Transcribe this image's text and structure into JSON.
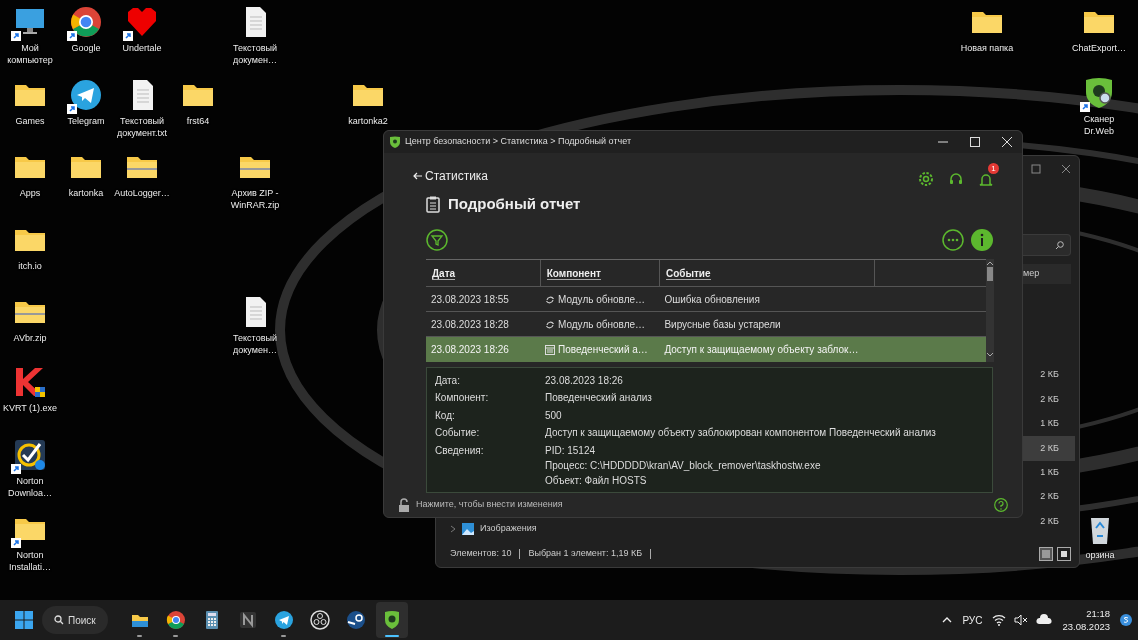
{
  "desktop_icons": [
    {
      "label": "Мой компьютер",
      "kind": "monitor",
      "shortcut": true
    },
    {
      "label": "Google",
      "kind": "chrome",
      "shortcut": true
    },
    {
      "label": "Undertale",
      "kind": "heart",
      "shortcut": true
    },
    {
      "label": "Текстовый докумен…",
      "kind": "document",
      "shortcut": false
    },
    {
      "label": "Новая папка",
      "kind": "folder",
      "shortcut": false
    },
    {
      "label": "ChatExport…",
      "kind": "folder",
      "shortcut": false
    },
    {
      "label": "Games",
      "kind": "folder",
      "shortcut": false
    },
    {
      "label": "Telegram",
      "kind": "telegram",
      "shortcut": true
    },
    {
      "label": "Текстовый документ.txt",
      "kind": "document",
      "shortcut": false
    },
    {
      "label": "frst64",
      "kind": "folder",
      "shortcut": false
    },
    {
      "label": "kartonka2",
      "kind": "folder",
      "shortcut": false
    },
    {
      "label": "Сканер Dr.Web",
      "kind": "drweb",
      "shortcut": true
    },
    {
      "label": "Apps",
      "kind": "folder",
      "shortcut": false
    },
    {
      "label": "kartonka",
      "kind": "folder",
      "shortcut": false
    },
    {
      "label": "AutoLogger…",
      "kind": "archive",
      "shortcut": false
    },
    {
      "label": "Архив ZIP - WinRAR.zip",
      "kind": "archive",
      "shortcut": false
    },
    {
      "label": "itch.io",
      "kind": "folder",
      "shortcut": false
    },
    {
      "label": "AVbr.zip",
      "kind": "archive",
      "shortcut": false
    },
    {
      "label": "Текстовый докумен…",
      "kind": "document",
      "shortcut": false
    },
    {
      "label": "KVRT (1).exe",
      "kind": "kaspersky",
      "shortcut": false
    },
    {
      "label": "Norton Downloa…",
      "kind": "norton",
      "shortcut": true
    },
    {
      "label": "Norton Installati…",
      "kind": "folder",
      "shortcut": true
    },
    {
      "label": "орзина",
      "kind": "recycle",
      "shortcut": false
    }
  ],
  "explorer_window": {
    "column_header": "мер",
    "sizes": [
      {
        "text": "2 КБ",
        "selected": false
      },
      {
        "text": "2 КБ",
        "selected": false
      },
      {
        "text": "1 КБ",
        "selected": false
      },
      {
        "text": "2 КБ",
        "selected": true
      },
      {
        "text": "1 КБ",
        "selected": false
      },
      {
        "text": "2 КБ",
        "selected": false
      },
      {
        "text": "2 КБ",
        "selected": false
      }
    ],
    "nav_item": "Изображения",
    "status": [
      "Элементов: 10",
      "Выбран 1 элемент: 1,19 КБ"
    ],
    "view_buttons": [
      {
        "kind": "details",
        "selected": true
      },
      {
        "kind": "tiles",
        "selected": false
      }
    ]
  },
  "security_window": {
    "title": "Центр безопасности > Статистика > Подробный отчет",
    "back_link": "Статистика",
    "heading": "Подробный отчет",
    "notification_count": "1",
    "table": {
      "columns": [
        "Дата",
        "Компонент",
        "Событие"
      ],
      "rows": [
        {
          "date": "23.08.2023 18:55",
          "kind": "update",
          "component": "Модуль обновле…",
          "event": "Ошибка обновления",
          "selected": false
        },
        {
          "date": "23.08.2023 18:28",
          "kind": "update",
          "component": "Модуль обновле…",
          "event": "Вирусные базы устарели",
          "selected": false
        },
        {
          "date": "23.08.2023 18:26",
          "kind": "behavior",
          "component": "Поведенческий а…",
          "event": "Доступ к защищаемому объекту заблок…",
          "selected": true
        }
      ]
    },
    "details": [
      {
        "label": "Дата:",
        "values": [
          "23.08.2023 18:26"
        ]
      },
      {
        "label": "Компонент:",
        "values": [
          "Поведенческий анализ"
        ]
      },
      {
        "label": "Код:",
        "values": [
          "500"
        ]
      },
      {
        "label": "Событие:",
        "values": [
          "Доступ к защищаемому объекту заблокирован компонентом Поведенческий анализ"
        ]
      },
      {
        "label": "Сведения:",
        "values": [
          "PID: 15124",
          "Процесс: C:\\HDDDDD\\kran\\AV_block_remover\\taskhostw.exe",
          "Объект: Файл HOSTS"
        ]
      }
    ],
    "footer_hint": "Нажмите, чтобы внести изменения"
  },
  "taskbar": {
    "search": "Поиск",
    "apps": [
      {
        "kind": "explorer",
        "running": true,
        "active": false
      },
      {
        "kind": "chrome",
        "running": true,
        "active": false
      },
      {
        "kind": "calculator",
        "running": false,
        "active": false
      },
      {
        "kind": "notion",
        "running": false,
        "active": false
      },
      {
        "kind": "telegram",
        "running": true,
        "active": false
      },
      {
        "kind": "obs",
        "running": false,
        "active": false
      },
      {
        "kind": "steam",
        "running": false,
        "active": false
      },
      {
        "kind": "drweb",
        "running": true,
        "active": true
      }
    ],
    "language": "РУС",
    "time": "21:18",
    "date": "23.08.2023"
  }
}
